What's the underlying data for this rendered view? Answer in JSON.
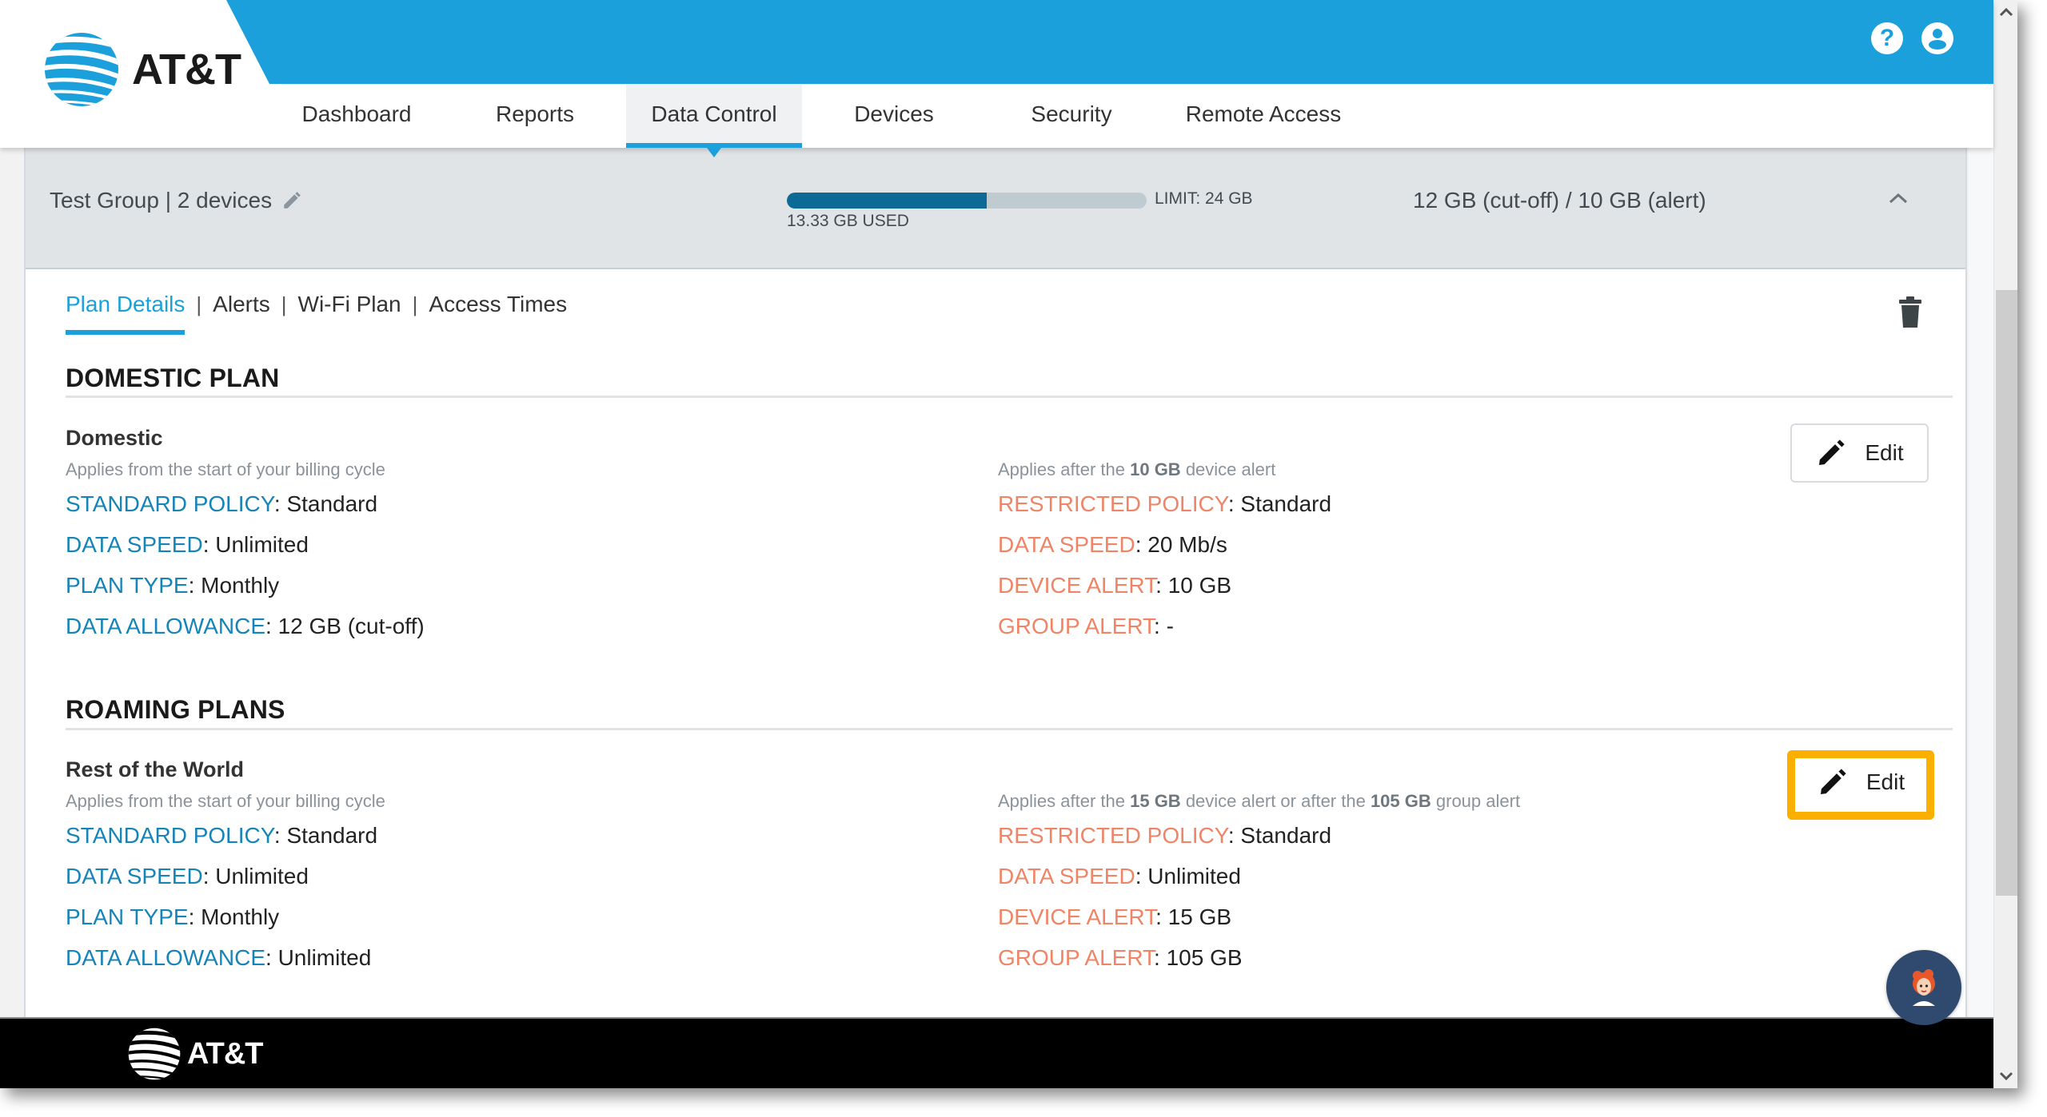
{
  "brand": {
    "name": "AT&T",
    "accent": "#1ba0db",
    "footer_name": "AT&T"
  },
  "header": {
    "icons": {
      "help": "help-circle-icon",
      "user": "account-circle-icon"
    }
  },
  "nav": {
    "items": [
      {
        "label": "Dashboard",
        "active": false
      },
      {
        "label": "Reports",
        "active": false
      },
      {
        "label": "Data Control",
        "active": true
      },
      {
        "label": "Devices",
        "active": false
      },
      {
        "label": "Security",
        "active": false
      },
      {
        "label": "Remote Access",
        "active": false
      }
    ]
  },
  "group": {
    "title": "Test Group | 2 devices",
    "usage": {
      "used_label": "13.33 GB USED",
      "limit_label": "LIMIT: 24 GB",
      "used_gb": 13.33,
      "limit_gb": 24,
      "fill_color": "#0d6a96"
    },
    "summary": "12 GB (cut-off) / 10 GB (alert)"
  },
  "tabs": [
    {
      "label": "Plan Details",
      "active": true
    },
    {
      "label": "Alerts",
      "active": false
    },
    {
      "label": "Wi-Fi Plan",
      "active": false
    },
    {
      "label": "Access Times",
      "active": false
    }
  ],
  "tab_separator": "|",
  "sections": {
    "domestic": {
      "heading": "DOMESTIC PLAN",
      "plan": {
        "title": "Domestic",
        "left_subtitle": "Applies from the start of your billing cycle",
        "right_subtitle": {
          "pre": "Applies after the ",
          "b1": "10 GB",
          "mid": " device alert",
          "b2": "",
          "post": ""
        },
        "standard": [
          {
            "key": "STANDARD POLICY",
            "value": "Standard"
          },
          {
            "key": "DATA SPEED",
            "value": "Unlimited"
          },
          {
            "key": "PLAN TYPE",
            "value": "Monthly"
          },
          {
            "key": "DATA ALLOWANCE",
            "value": "12 GB (cut-off)"
          }
        ],
        "restricted": [
          {
            "key": "RESTRICTED POLICY",
            "value": "Standard"
          },
          {
            "key": "DATA SPEED",
            "value": "20 Mb/s"
          },
          {
            "key": "DEVICE ALERT",
            "value": "10 GB"
          },
          {
            "key": "GROUP ALERT",
            "value": "-"
          }
        ],
        "edit_label": "Edit"
      }
    },
    "roaming": {
      "heading": "ROAMING PLANS",
      "plan": {
        "title": "Rest of the World",
        "left_subtitle": "Applies from the start of your billing cycle",
        "right_subtitle": {
          "pre": "Applies after the ",
          "b1": "15 GB",
          "mid": " device alert or after the ",
          "b2": "105 GB",
          "post": " group alert"
        },
        "standard": [
          {
            "key": "STANDARD POLICY",
            "value": "Standard"
          },
          {
            "key": "DATA SPEED",
            "value": "Unlimited"
          },
          {
            "key": "PLAN TYPE",
            "value": "Monthly"
          },
          {
            "key": "DATA ALLOWANCE",
            "value": "Unlimited"
          }
        ],
        "restricted": [
          {
            "key": "RESTRICTED POLICY",
            "value": "Standard"
          },
          {
            "key": "DATA SPEED",
            "value": "Unlimited"
          },
          {
            "key": "DEVICE ALERT",
            "value": "15 GB"
          },
          {
            "key": "GROUP ALERT",
            "value": "105 GB"
          }
        ],
        "edit_label": "Edit",
        "highlighted": true
      }
    }
  },
  "colors": {
    "standard_key": "#1784b8",
    "restricted_key": "#ef8466",
    "highlight": "#fbb000",
    "header_blue": "#1ba0db",
    "footer": "#000000",
    "chat_bubble": "#2f4a6e"
  },
  "scrollbar": {
    "position_fraction": 0.35
  },
  "chat": {
    "icon": "virtual-assistant-avatar-icon"
  }
}
